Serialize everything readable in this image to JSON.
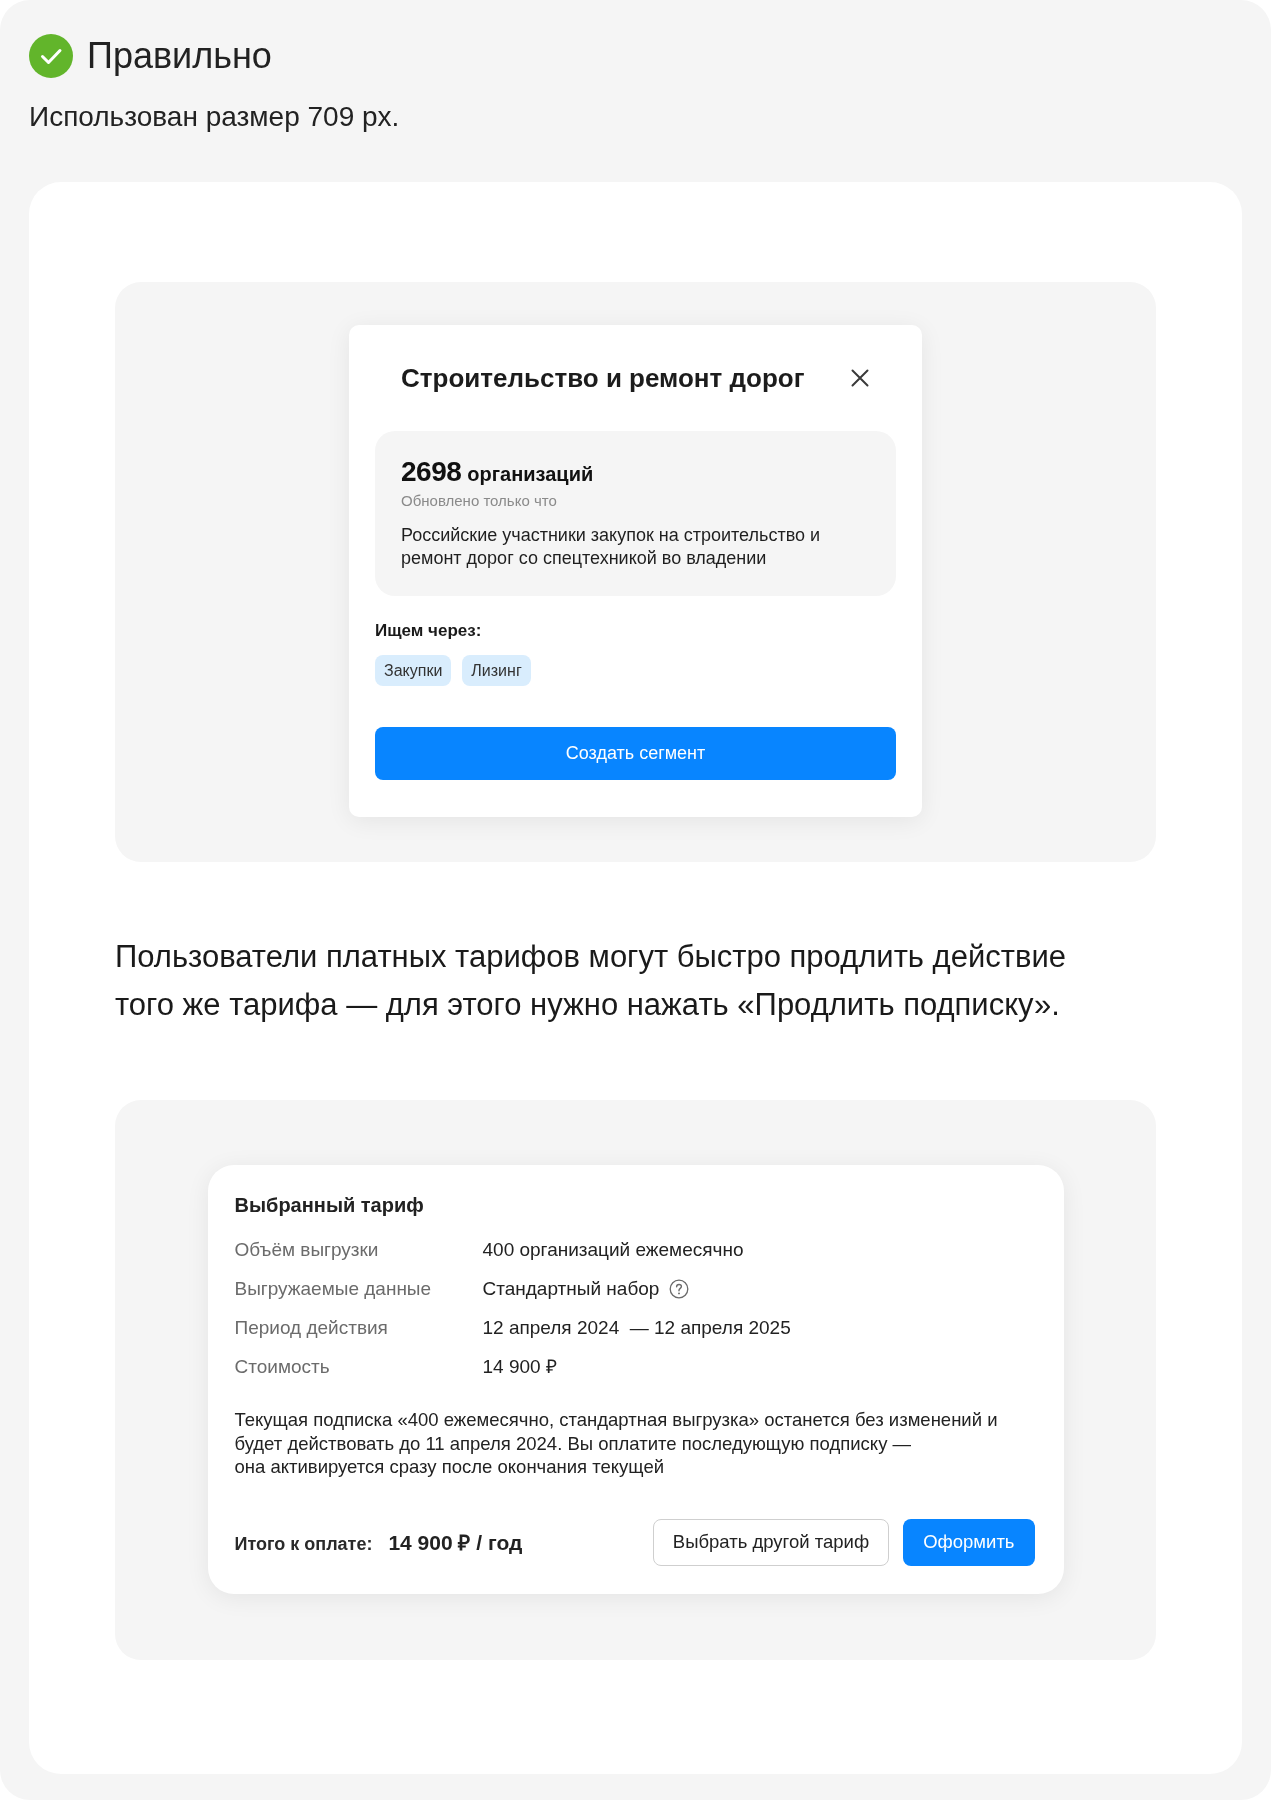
{
  "header": {
    "kind": "correct",
    "title": "Правильно",
    "subtitle": "Использован размер 709 px."
  },
  "modal": {
    "title": "Строительство и ремонт дорог",
    "count": "2698",
    "count_label": "организаций",
    "updated": "Обновлено только что",
    "description": "Российские участники закупок на строительство и ремонт дорог со спецтехникой во владении",
    "search_label": "Ищем через:",
    "tags": [
      "Закупки",
      "Лизинг"
    ],
    "button": "Создать сегмент"
  },
  "paragraph": "Пользователи платных тарифов могут быстро продлить действие того же тарифа — для этого нужно нажать «Продлить подписку».",
  "tariff_card": {
    "title": "Выбранный тариф",
    "rows": [
      {
        "label": "Объём выгрузки",
        "value": "400 организаций ежемесячно",
        "help": false
      },
      {
        "label": "Выгружаемые данные",
        "value": "Стандартный набор",
        "help": true
      },
      {
        "label": "Период действия",
        "value": "12 апреля 2024  — 12 апреля 2025",
        "help": false
      },
      {
        "label": "Стоимость",
        "value": "14 900 ₽",
        "help": false
      }
    ],
    "note": "Текущая подписка «400 ежемесячно, стандартная выгрузка» останется без изменений и будет действовать до 11 апреля 2024. Вы оплатите последующую подписку —\nона активируется сразу после окончания текущей",
    "total_label": "Итого к оплате:",
    "total_value": "14 900 ₽ / год",
    "buttons": [
      {
        "label": "Выбрать другой тариф",
        "kind": "secondary"
      },
      {
        "label": "Оформить",
        "kind": "primary"
      }
    ]
  }
}
